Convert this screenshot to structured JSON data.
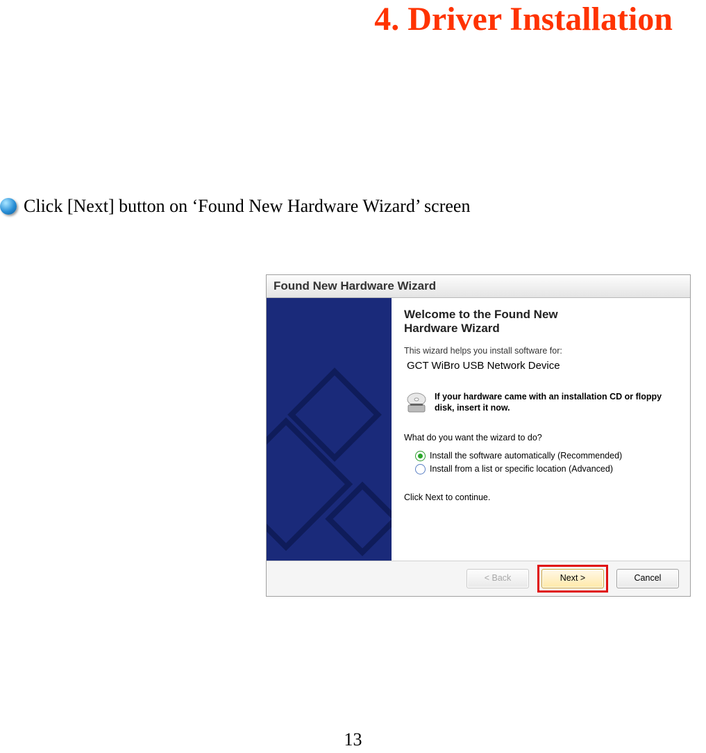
{
  "page": {
    "heading": "4. Driver Installation",
    "instruction": "Click [Next] button on ‘Found New Hardware Wizard’ screen",
    "number": "13"
  },
  "wizard": {
    "title": "Found New Hardware Wizard",
    "welcome_line1": "Welcome to the Found New",
    "welcome_line2": "Hardware Wizard",
    "helps_text": "This wizard helps you install software for:",
    "device_name": "GCT WiBro USB Network Device",
    "cd_text": "If your hardware came with an installation CD or floppy disk, insert it now.",
    "question": "What do you want the wizard to do?",
    "option1": "Install the software automatically (Recommended)",
    "option2": "Install from a list or specific location (Advanced)",
    "click_next": "Click Next to continue.",
    "buttons": {
      "back": "< Back",
      "next": "Next >",
      "cancel": "Cancel"
    }
  }
}
